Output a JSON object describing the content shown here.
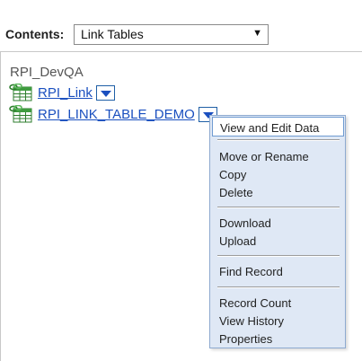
{
  "toolbar": {
    "contents_label": "Contents:",
    "contents_value": "Link Tables",
    "dropdown_arrow": "▼"
  },
  "tree": {
    "root_label": "RPI_DevQA",
    "items": [
      {
        "label": "RPI_Link",
        "icon": "linked-table-icon"
      },
      {
        "label": "RPI_LINK_TABLE_DEMO",
        "icon": "linked-table-icon"
      }
    ]
  },
  "context_menu": {
    "active_item": "View and Edit Data",
    "groups": [
      [
        "View and Edit Data"
      ],
      [
        "Move or Rename",
        "Copy",
        "Delete"
      ],
      [
        "Download",
        "Upload"
      ],
      [
        "Find Record"
      ],
      [
        "Record Count",
        "View History",
        "Properties"
      ]
    ]
  },
  "colors": {
    "link": "#1a4fbf",
    "menu_background": "#dfe8f5",
    "menu_border": "#8eaad0"
  }
}
